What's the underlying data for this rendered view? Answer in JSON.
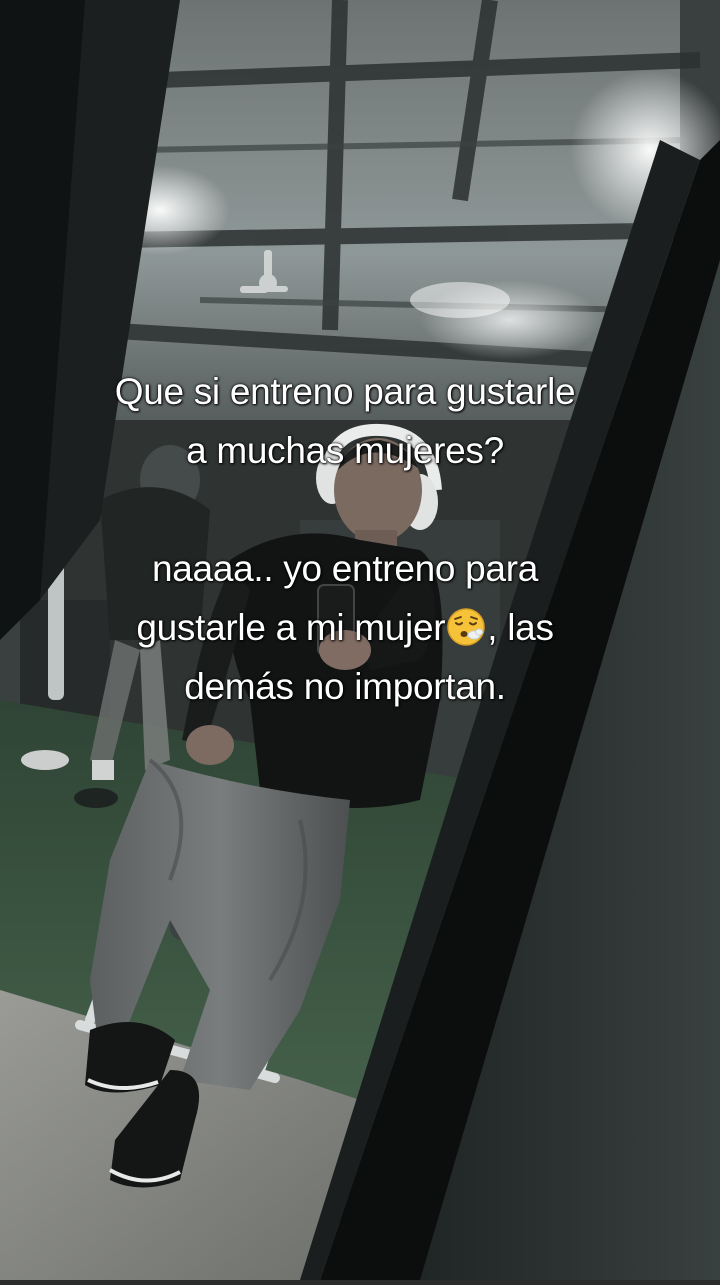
{
  "caption": {
    "line1": "Que si entreno para gustarle",
    "line2": "a muchas mujeres?",
    "line3": "naaaa.. yo entreno para",
    "line4_before_emoji": "gustarle a mi mujer",
    "line4_after_emoji": ", las",
    "line5": "demás no importan."
  },
  "emoji": {
    "name": "sighing-face-emoji",
    "color": "#f5c23a"
  },
  "colors": {
    "ceiling": "#8f9898",
    "turf": "#3e5a44",
    "floor": "#8a8b87",
    "mirror_frame": "#121414",
    "wall": "#2e3434"
  }
}
